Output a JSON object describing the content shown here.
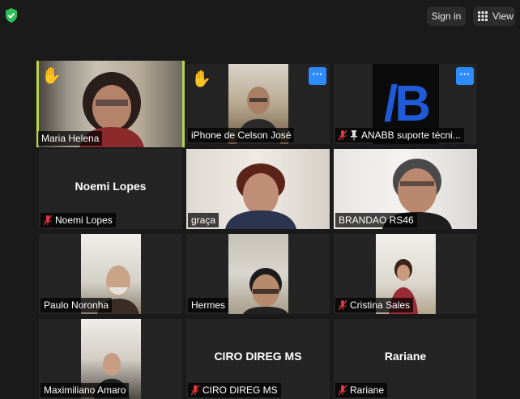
{
  "topbar": {
    "signin_label": "Sign in",
    "view_label": "View"
  },
  "participants": [
    {
      "name": "Maria Helena",
      "muted": false,
      "hand": true
    },
    {
      "name": "iPhone de Celson José",
      "muted": false,
      "hand": true
    },
    {
      "name": "ANABB suporte técni...",
      "muted": true,
      "pinned": true,
      "logo": "/B"
    },
    {
      "name": "Noemi Lopes",
      "muted": true,
      "display": "Noemi Lopes"
    },
    {
      "name": "graça",
      "muted": false
    },
    {
      "name": "BRANDAO RS46",
      "muted": false
    },
    {
      "name": "Paulo Noronha",
      "muted": false
    },
    {
      "name": "Hermes",
      "muted": false
    },
    {
      "name": "Cristina Sales",
      "muted": true
    },
    {
      "name": "Maximiliano Amaro",
      "muted": false
    },
    {
      "name": "CIRO DIREG MS",
      "muted": true,
      "display": "CIRO DIREG MS"
    },
    {
      "name": "Rariane",
      "muted": true,
      "display": "Rariane"
    }
  ],
  "colors": {
    "active_speaker_border": "#b9d74a",
    "more_button": "#2d8cff",
    "muted_icon": "#e0383e",
    "shield": "#2ebd59"
  },
  "icons": {
    "shield": "shield-check-icon",
    "hand": "raised-hand-icon",
    "muted": "microphone-muted-icon",
    "pin": "pin-icon",
    "more": "more-options-icon",
    "view": "grid-view-icon"
  }
}
